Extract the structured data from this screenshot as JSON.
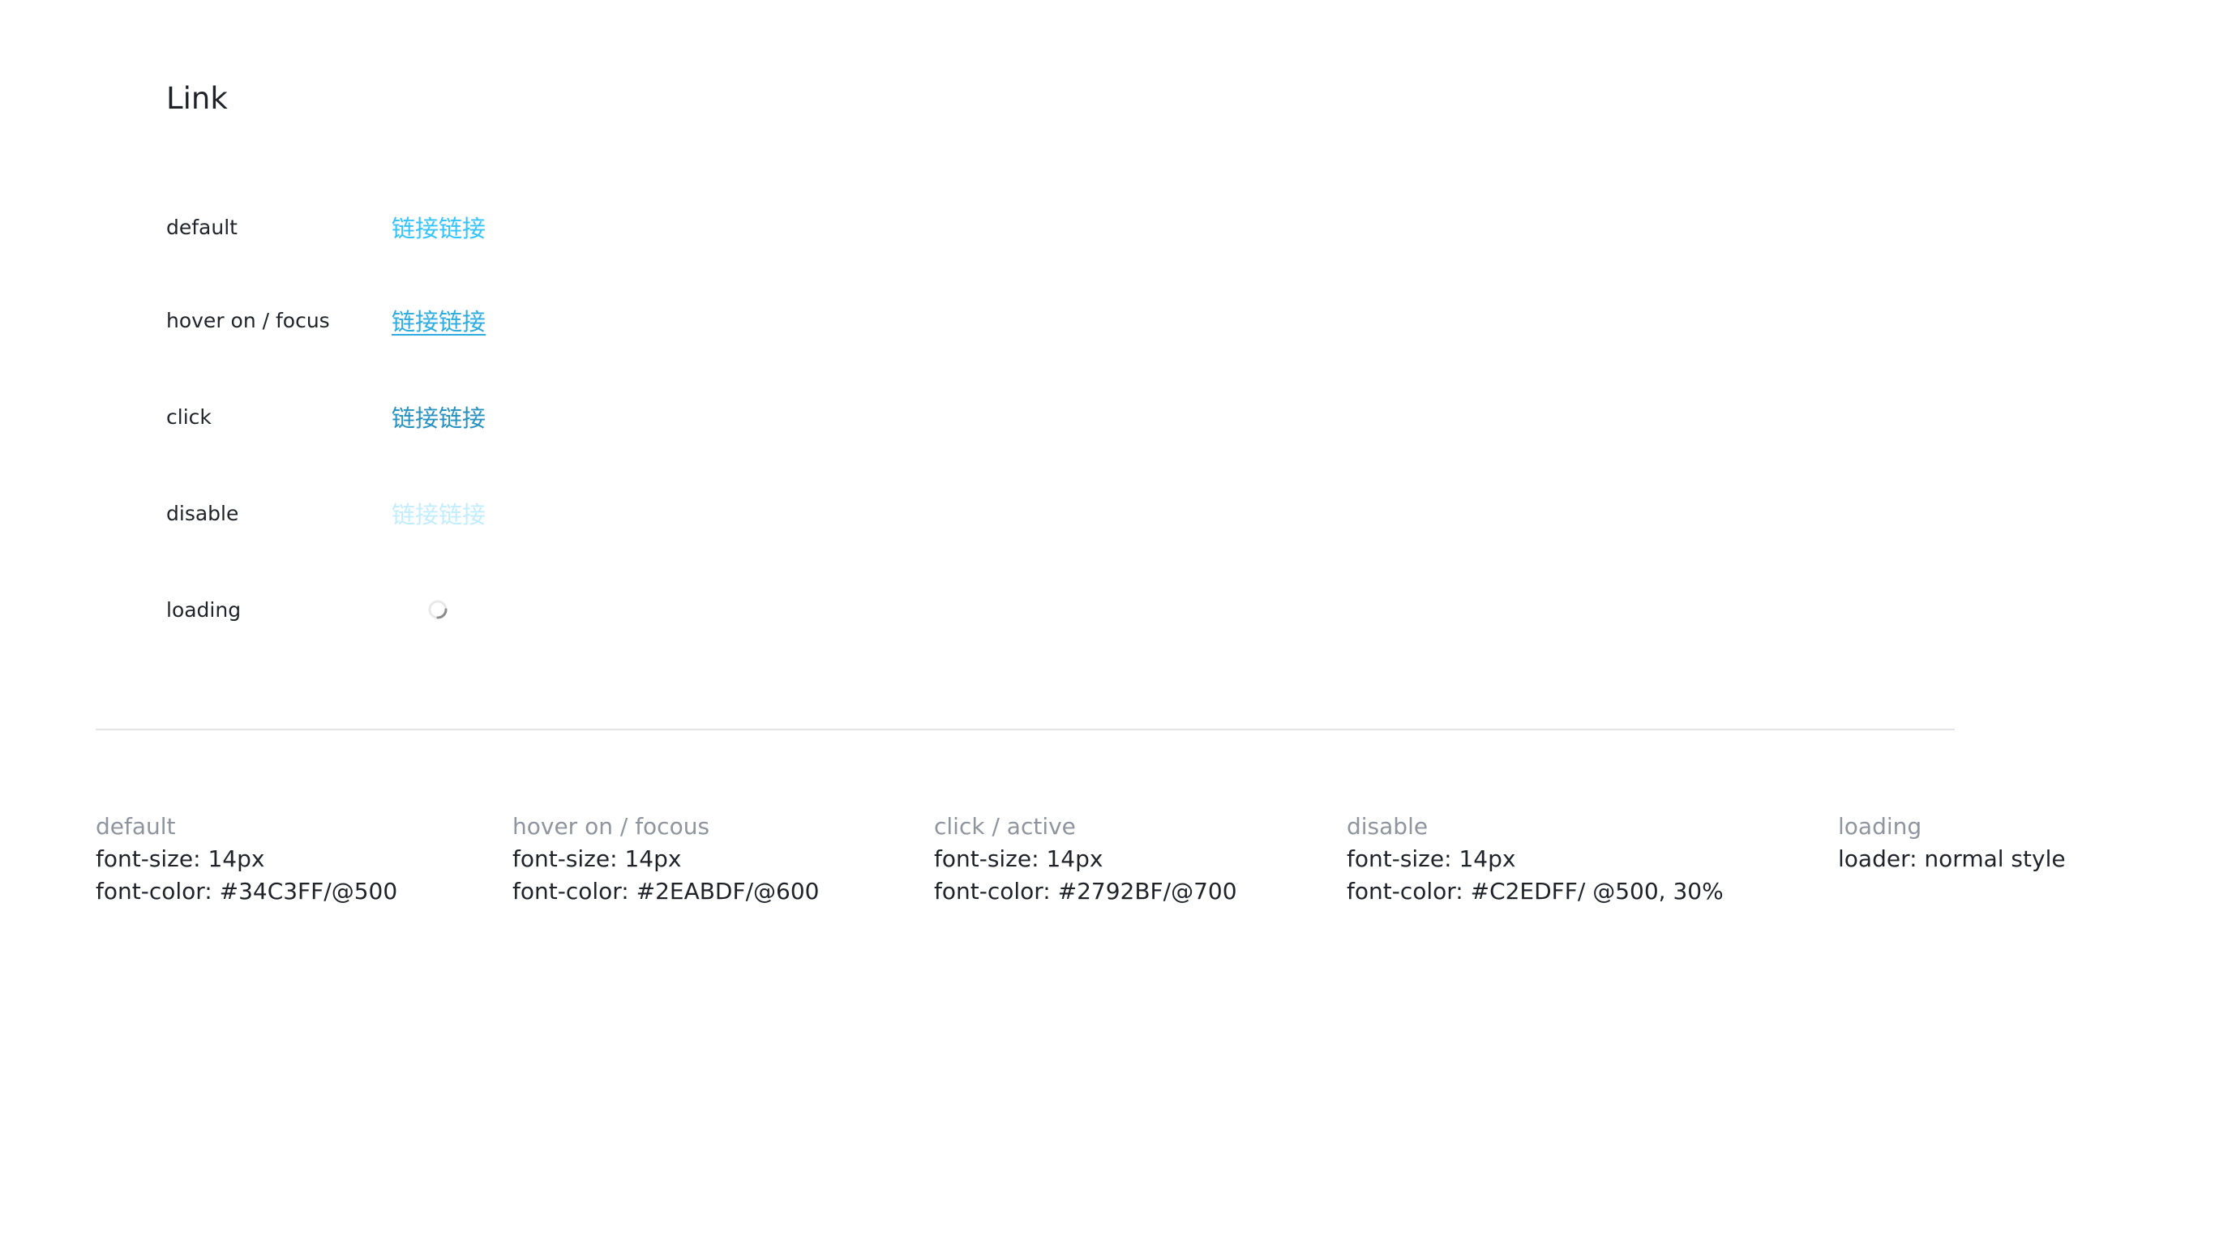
{
  "title": "Link",
  "states": [
    {
      "label": "default",
      "link_text": "链接链接"
    },
    {
      "label": "hover on / focus",
      "link_text": "链接链接"
    },
    {
      "label": "click",
      "link_text": "链接链接"
    },
    {
      "label": "disable",
      "link_text": "链接链接"
    },
    {
      "label": "loading",
      "icon": "spinner-icon"
    }
  ],
  "colors": {
    "default": "#34C3FF",
    "hover": "#2EABDF",
    "click": "#2792BF",
    "disable": "#C2EDFF"
  },
  "specs": [
    {
      "heading": "default",
      "lines": [
        "font-size: 14px",
        "font-color: #34C3FF/@500"
      ]
    },
    {
      "heading": "hover on / focous",
      "lines": [
        "font-size: 14px",
        "font-color: #2EABDF/@600"
      ]
    },
    {
      "heading": "click / active",
      "lines": [
        "font-size: 14px",
        "font-color: #2792BF/@700"
      ]
    },
    {
      "heading": "disable",
      "lines": [
        "font-size: 14px",
        "font-color: #C2EDFF/ @500, 30%"
      ]
    },
    {
      "heading": "loading",
      "lines": [
        "loader: normal style"
      ]
    }
  ]
}
